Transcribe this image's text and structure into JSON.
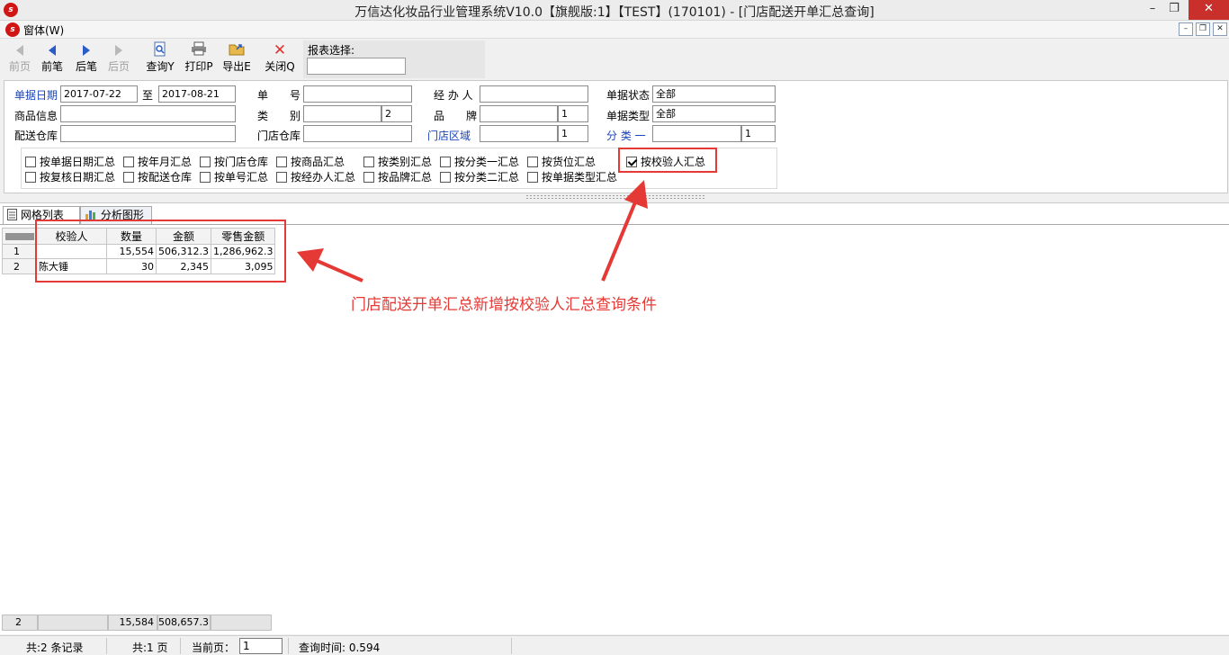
{
  "window": {
    "title": "万信达化妆品行业管理系统V10.0【旗舰版:1】【TEST】(170101) - [门店配送开单汇总查询]",
    "logo_text": "s",
    "minimize": "–",
    "restore": "❐",
    "close": "✕"
  },
  "menubar": {
    "menu": "窗体(W)",
    "mdi_min": "–",
    "mdi_restore": "❐",
    "mdi_close": "✕"
  },
  "toolbar": {
    "buttons": [
      {
        "label": "前页",
        "enabled": false
      },
      {
        "label": "前笔",
        "enabled": true
      },
      {
        "label": "后笔",
        "enabled": true
      },
      {
        "label": "后页",
        "enabled": false
      },
      {
        "label": "查询Y",
        "enabled": true
      },
      {
        "label": "打印P",
        "enabled": true
      },
      {
        "label": "导出E",
        "enabled": true
      },
      {
        "label": "关闭Q",
        "enabled": true
      }
    ],
    "report_select_label": "报表选择:",
    "report_select_value": ""
  },
  "filters": {
    "date_label": "单据日期",
    "date_from": "2017-07-22",
    "to_label": "至",
    "date_to": "2017-08-21",
    "doc_no_label": "单　　号",
    "doc_no": "",
    "handler_label": "经 办 人",
    "handler": "",
    "doc_status_label": "单据状态",
    "doc_status": "全部",
    "product_label": "商品信息",
    "product": "",
    "category_label": "类　　别",
    "category": "",
    "category_level": "2",
    "brand_label": "品　　牌",
    "brand": "",
    "brand_level": "1",
    "doc_type_label": "单据类型",
    "doc_type": "全部",
    "dist_wh_label": "配送仓库",
    "dist_wh": "",
    "store_wh_label": "门店仓库",
    "store_wh": "",
    "store_area_label": "门店区域",
    "store_area": "",
    "store_area_level": "1",
    "class1_label": "分 类 一",
    "class1": "",
    "class1_level": "1"
  },
  "checkboxes": [
    {
      "label": "按单据日期汇总",
      "checked": false
    },
    {
      "label": "按年月汇总",
      "checked": false
    },
    {
      "label": "按门店仓库",
      "checked": false
    },
    {
      "label": "按商品汇总",
      "checked": false
    },
    {
      "label": "按类别汇总",
      "checked": false
    },
    {
      "label": "按分类一汇总",
      "checked": false
    },
    {
      "label": "按货位汇总",
      "checked": false
    },
    {
      "label": "按校验人汇总",
      "checked": true
    },
    {
      "label": "按复核日期汇总",
      "checked": false
    },
    {
      "label": "按配送仓库",
      "checked": false
    },
    {
      "label": "按单号汇总",
      "checked": false
    },
    {
      "label": "按经办人汇总",
      "checked": false
    },
    {
      "label": "按品牌汇总",
      "checked": false
    },
    {
      "label": "按分类二汇总",
      "checked": false
    },
    {
      "label": "按单据类型汇总",
      "checked": false
    }
  ],
  "tabs": [
    {
      "label": "网格列表",
      "active": true
    },
    {
      "label": "分析图形",
      "active": false
    }
  ],
  "grid": {
    "columns": [
      "校验人",
      "数量",
      "金额",
      "零售金额"
    ],
    "rows": [
      {
        "n": "1",
        "checker": "",
        "qty": "15,554",
        "amount": "506,312.3",
        "retail": "1,286,962.3"
      },
      {
        "n": "2",
        "checker": "陈大锤",
        "qty": "30",
        "amount": "2,345",
        "retail": "3,095"
      }
    ]
  },
  "annotation": "门店配送开单汇总新增按校验人汇总查询条件",
  "totals": {
    "count": "2",
    "qty": "15,584",
    "amount": "508,657.3"
  },
  "status": {
    "records": "共:2 条记录",
    "pages": "共:1 页",
    "current_page_label": "当前页：",
    "current_page": "1",
    "query_time": "查询时间: 0.594"
  },
  "colors": {
    "highlight": "#e53935",
    "label_blue": "#1b44b8",
    "close_red": "#c9302c"
  }
}
